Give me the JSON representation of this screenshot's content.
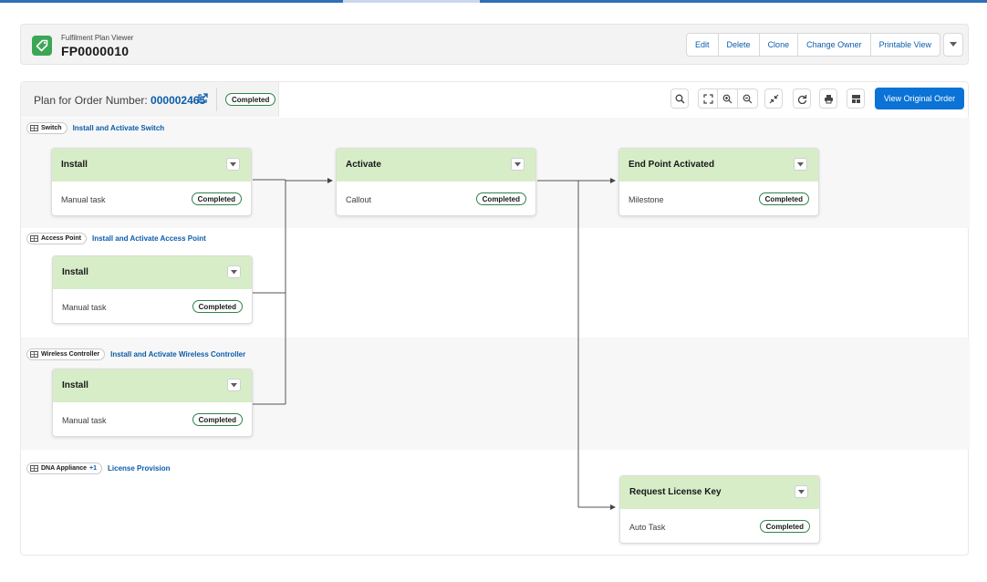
{
  "header": {
    "subtitle": "Fulfilment Plan Viewer",
    "title": "FP0000010",
    "icon": "tag-icon",
    "actions": [
      "Edit",
      "Delete",
      "Clone",
      "Change Owner",
      "Printable View"
    ]
  },
  "plan": {
    "label": "Plan for Order Number: ",
    "order_number": "000002465",
    "status": "Completed",
    "view_original_label": "View Original Order"
  },
  "toolbar": {
    "icons": [
      "search-icon",
      "fit-screen-icon",
      "zoom-in-icon",
      "zoom-out-icon",
      "collapse-icon",
      "refresh-icon",
      "print-icon",
      "layout-icon"
    ]
  },
  "lanes": [
    {
      "chip": "Switch",
      "link": "Install and Activate Switch"
    },
    {
      "chip": "Access Point",
      "link": "Install and Activate Access Point"
    },
    {
      "chip": "Wireless Controller",
      "link": "Install and Activate Wireless Controller"
    },
    {
      "chip": "DNA Appliance",
      "chip_count": "+1",
      "link": "License Provision"
    }
  ],
  "cards": [
    {
      "title": "Install",
      "type": "Manual task",
      "status": "Completed"
    },
    {
      "title": "Activate",
      "type": "Callout",
      "status": "Completed"
    },
    {
      "title": "End Point Activated",
      "type": "Milestone",
      "status": "Completed"
    },
    {
      "title": "Install",
      "type": "Manual task",
      "status": "Completed"
    },
    {
      "title": "Install",
      "type": "Manual task",
      "status": "Completed"
    },
    {
      "title": "Request License Key",
      "type": "Auto Task",
      "status": "Completed"
    }
  ],
  "colors": {
    "accent": "#0b5cab",
    "primary_button": "#0b72d6",
    "card_header": "#d7edc8",
    "header_icon": "#3ba755",
    "badge_border": "#2e844a"
  }
}
